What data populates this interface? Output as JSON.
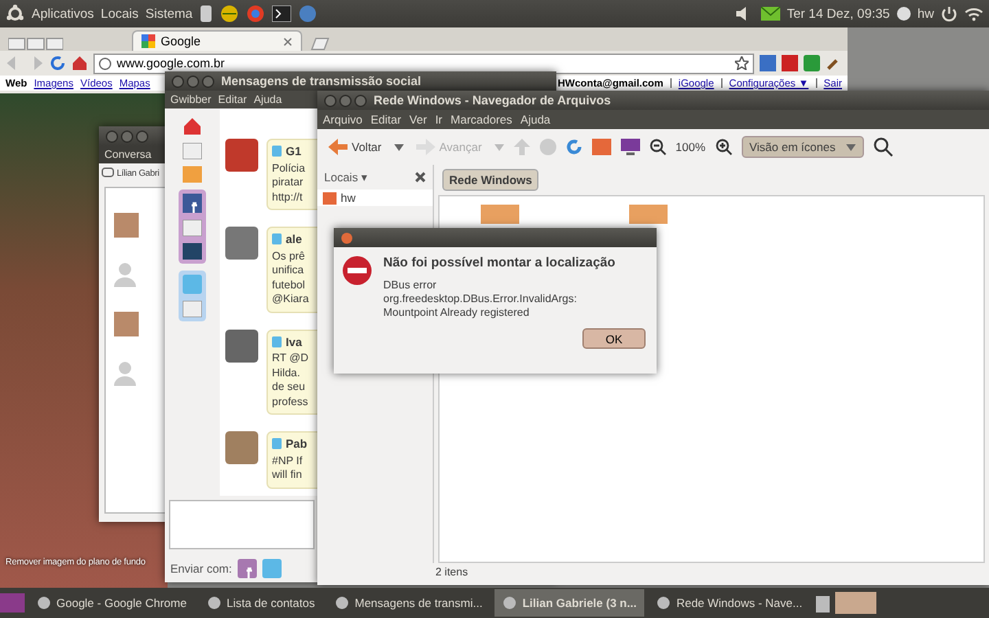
{
  "top_panel": {
    "menus": [
      "Aplicativos",
      "Locais",
      "Sistema"
    ],
    "clock": "Ter 14 Dez, 09:35",
    "user": "hw"
  },
  "browser": {
    "tab": "Google",
    "url": "www.google.com.br",
    "nav_links": [
      {
        "label": "Web",
        "selected": true
      },
      {
        "label": "Imagens",
        "selected": false
      },
      {
        "label": "Vídeos",
        "selected": false
      },
      {
        "label": "Mapas",
        "selected": false
      }
    ],
    "account": "HWconta@gmail.com",
    "account_links": [
      "iGoogle",
      "Configurações ▼",
      "Sair"
    ]
  },
  "chat_window": {
    "menus": [
      "Conversa"
    ],
    "contact": "Lílian Gabri"
  },
  "gwibber": {
    "title": "Mensagens de transmissão social",
    "menus": [
      "Gwibber",
      "Editar",
      "Ajuda"
    ],
    "messages": [
      {
        "sender": "G1",
        "lines": [
          "Polícia",
          "piratar",
          "http://t"
        ]
      },
      {
        "sender": "ale",
        "lines": [
          "Os prê",
          "unifica",
          "futebol",
          "@Kiara"
        ]
      },
      {
        "sender": "Iva",
        "lines": [
          "RT @D",
          "Hilda.",
          "de seu",
          "profess"
        ]
      },
      {
        "sender": "Pab",
        "lines": [
          "#NP If",
          "will fin"
        ]
      }
    ],
    "send_with": "Enviar com:"
  },
  "file_manager": {
    "title": "Rede Windows - Navegador de Arquivos",
    "menus": [
      "Arquivo",
      "Editar",
      "Ver",
      "Ir",
      "Marcadores",
      "Ajuda"
    ],
    "back": {
      "label": "Voltar",
      "disabled": false
    },
    "forward": {
      "label": "Avançar",
      "disabled": true
    },
    "zoom": "100%",
    "view": "Visão em ícones",
    "sidebar_title": "Locais ▾",
    "places": [
      "hw"
    ],
    "path": "Rede Windows",
    "status": "2 itens"
  },
  "dialog": {
    "heading": "Não foi possível montar a localização",
    "lines": [
      "DBus error",
      "org.freedesktop.DBus.Error.InvalidArgs:",
      "Mountpoint Already registered"
    ],
    "button": "OK"
  },
  "desktop_text": "Remover imagem do plano de fundo",
  "taskbar": [
    {
      "label": "Google - Google Chrome",
      "selected": false
    },
    {
      "label": "Lista de contatos",
      "selected": false
    },
    {
      "label": "Mensagens de transmi...",
      "selected": false
    },
    {
      "label": "Lilian Gabriele (3 n...",
      "selected": true
    },
    {
      "label": "Rede Windows - Nave...",
      "selected": false
    }
  ]
}
